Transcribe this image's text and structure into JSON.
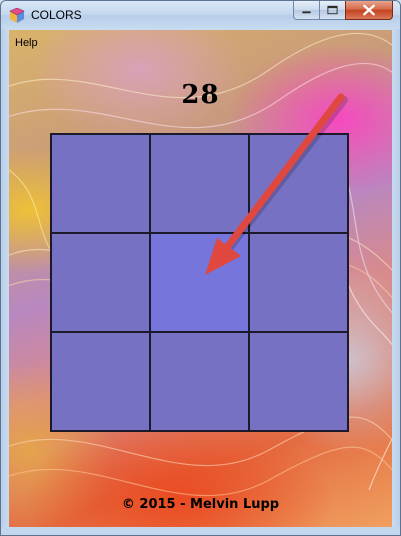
{
  "window": {
    "title": "COLORS",
    "icon": "colors-app-icon",
    "controls": [
      "minimize-icon",
      "maximize-icon",
      "close-icon"
    ]
  },
  "menu": {
    "items": [
      "Help"
    ]
  },
  "game": {
    "score": "28",
    "grid": {
      "rows": 3,
      "cols": 3,
      "cells": [
        {
          "row": 0,
          "col": 0,
          "color": "#7771c4"
        },
        {
          "row": 0,
          "col": 1,
          "color": "#7771c4"
        },
        {
          "row": 0,
          "col": 2,
          "color": "#7771c4"
        },
        {
          "row": 1,
          "col": 0,
          "color": "#7771c4"
        },
        {
          "row": 1,
          "col": 1,
          "color": "#7575dc"
        },
        {
          "row": 1,
          "col": 2,
          "color": "#7771c4"
        },
        {
          "row": 2,
          "col": 0,
          "color": "#7771c4"
        },
        {
          "row": 2,
          "col": 1,
          "color": "#7771c4"
        },
        {
          "row": 2,
          "col": 2,
          "color": "#7771c4"
        }
      ],
      "odd_cell": {
        "row": 1,
        "col": 1
      }
    },
    "pointer_arrow_color": "#e0473f"
  },
  "footer": {
    "copyright": "© 2015 - Melvin Lupp"
  }
}
